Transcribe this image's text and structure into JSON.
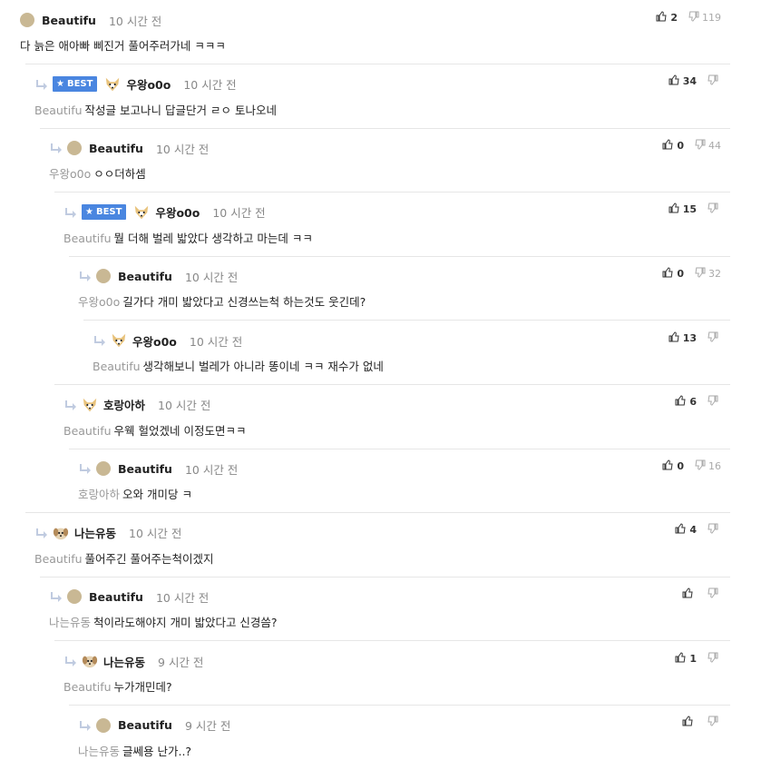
{
  "comments": [
    {
      "depth": 0,
      "nick": "Beautifu",
      "avatar": "circle",
      "time": "10 시간 전",
      "mention": "",
      "text": "다 늙은 애아빠 삐진거 풀어주러가네 ㅋㅋㅋ",
      "up": "2",
      "down": "119",
      "best": false
    },
    {
      "depth": 1,
      "nick": "우왕o0o",
      "avatar": "fox",
      "time": "10 시간 전",
      "mention": "Beautifu",
      "text": "작성글 보고나니 답글단거 ㄹㅇ 토나오네",
      "up": "34",
      "down": "",
      "best": true
    },
    {
      "depth": 2,
      "nick": "Beautifu",
      "avatar": "circle",
      "time": "10 시간 전",
      "mention": "우왕o0o",
      "text": "ㅇㅇ더하셈",
      "up": "0",
      "down": "44",
      "best": false
    },
    {
      "depth": 3,
      "nick": "우왕o0o",
      "avatar": "fox",
      "time": "10 시간 전",
      "mention": "Beautifu",
      "text": "뭘 더해 벌레 밟았다 생각하고 마는데 ㅋㅋ",
      "up": "15",
      "down": "",
      "best": true
    },
    {
      "depth": 4,
      "nick": "Beautifu",
      "avatar": "circle",
      "time": "10 시간 전",
      "mention": "우왕o0o",
      "text": "길가다 개미 밟았다고 신경쓰는척 하는것도 웃긴데?",
      "up": "0",
      "down": "32",
      "best": false
    },
    {
      "depth": 5,
      "nick": "우왕o0o",
      "avatar": "fox",
      "time": "10 시간 전",
      "mention": "Beautifu",
      "text": "생각해보니 벌레가 아니라 똥이네 ㅋㅋ 재수가 없네",
      "up": "13",
      "down": "",
      "best": false
    },
    {
      "depth": 3,
      "nick": "호랑아하",
      "avatar": "fox",
      "time": "10 시간 전",
      "mention": "Beautifu",
      "text": "우웩 헐었겠네 이정도면ㅋㅋ",
      "up": "6",
      "down": "",
      "best": false
    },
    {
      "depth": 4,
      "nick": "Beautifu",
      "avatar": "circle",
      "time": "10 시간 전",
      "mention": "호랑아하",
      "text": "오와 개미당 ㅋ",
      "up": "0",
      "down": "16",
      "best": false
    },
    {
      "depth": 1,
      "nick": "나는유동",
      "avatar": "dog",
      "time": "10 시간 전",
      "mention": "Beautifu",
      "text": "풀어주긴 풀어주는척이겠지",
      "up": "4",
      "down": "",
      "best": false
    },
    {
      "depth": 2,
      "nick": "Beautifu",
      "avatar": "circle",
      "time": "10 시간 전",
      "mention": "나는유동",
      "text": "척이라도해야지 개미 밟았다고 신경씀?",
      "up": "",
      "down": "",
      "best": false
    },
    {
      "depth": 3,
      "nick": "나는유동",
      "avatar": "dog",
      "time": "9 시간 전",
      "mention": "Beautifu",
      "text": "누가개민데?",
      "up": "1",
      "down": "",
      "best": false
    },
    {
      "depth": 4,
      "nick": "Beautifu",
      "avatar": "circle",
      "time": "9 시간 전",
      "mention": "나는유동",
      "text": "글쎄용 난가..?",
      "up": "",
      "down": "",
      "best": false
    }
  ],
  "labels": {
    "best": "BEST"
  },
  "colors": {
    "best_badge": "#4a86e0",
    "mention": "#999999",
    "time": "#888888"
  }
}
